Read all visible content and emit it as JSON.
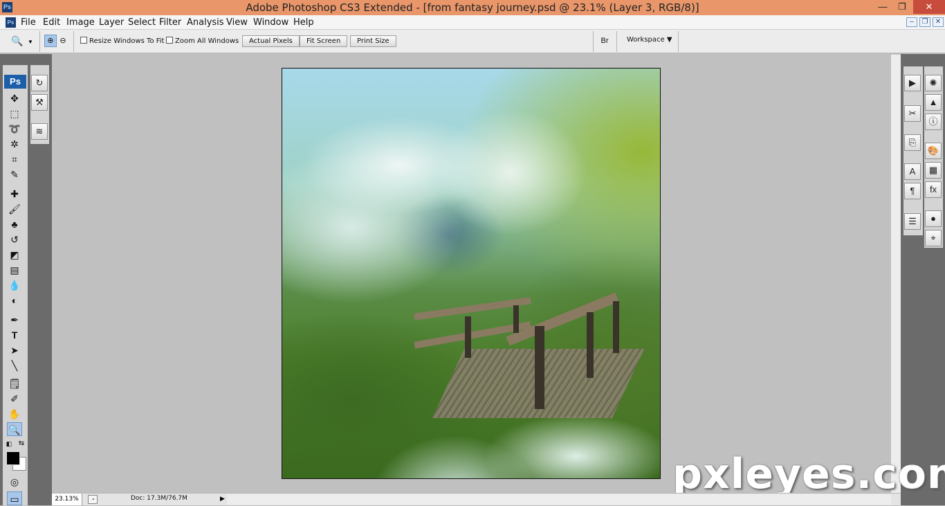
{
  "window": {
    "title": "Adobe Photoshop CS3 Extended - [from fantasy journey.psd @ 23.1% (Layer 3, RGB/8)]",
    "min_label": "—",
    "max_label": "❐",
    "close_label": "✕"
  },
  "menu": {
    "items": [
      "File",
      "Edit",
      "Image",
      "Layer",
      "Select",
      "Filter",
      "Analysis",
      "View",
      "Window",
      "Help"
    ]
  },
  "options": {
    "resize_windows_label": "Resize Windows To Fit",
    "zoom_all_label": "Zoom All Windows",
    "actual_pixels": "Actual Pixels",
    "fit_screen": "Fit Screen",
    "print_size": "Print Size",
    "workspace": "Workspace ▼"
  },
  "status": {
    "zoom": "23.13%",
    "doc": "Doc: 17.3M/76.7M"
  },
  "watermark": "pxleyes.com",
  "logo_text": "Ps"
}
